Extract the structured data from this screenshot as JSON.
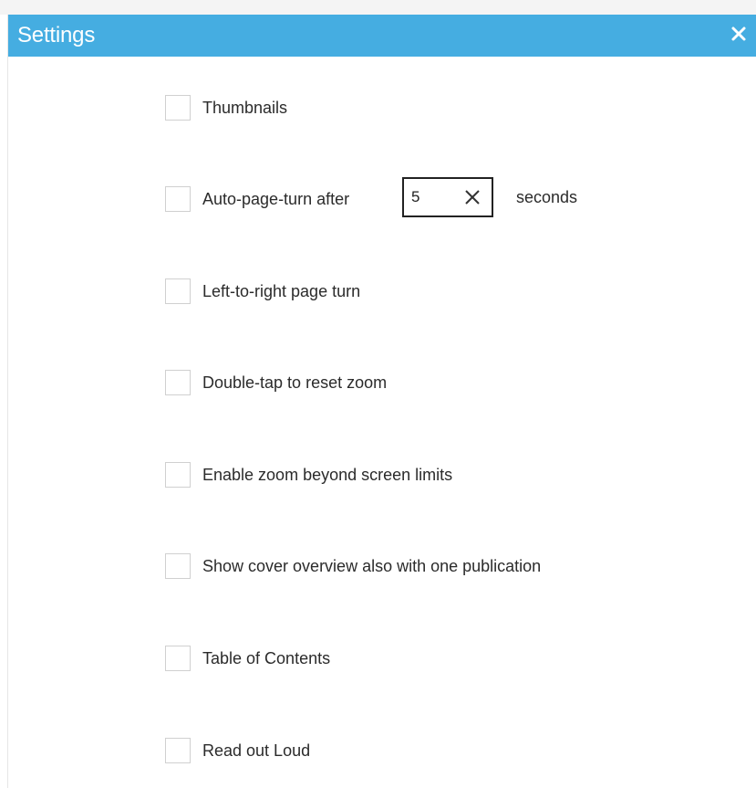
{
  "dialog": {
    "title": "Settings",
    "close_icon": "close-icon"
  },
  "options": [
    {
      "label": "Thumbnails",
      "checked": false
    },
    {
      "label": "Auto-page-turn after",
      "checked": false
    },
    {
      "label": "Left-to-right page turn",
      "checked": false
    },
    {
      "label": "Double-tap to reset zoom",
      "checked": false
    },
    {
      "label": "Enable zoom beyond screen limits",
      "checked": false
    },
    {
      "label": "Show cover overview also with one publication",
      "checked": false
    },
    {
      "label": "Table of Contents",
      "checked": false
    },
    {
      "label": "Read out Loud",
      "checked": false
    }
  ],
  "auto_page_turn": {
    "value": "5",
    "unit_label": "seconds",
    "clear_icon": "clear-icon"
  },
  "colors": {
    "titlebar": "#45ade1",
    "title_text": "#ffffff"
  }
}
